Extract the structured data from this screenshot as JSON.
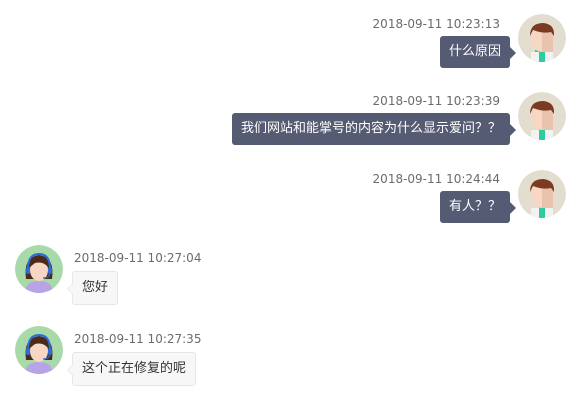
{
  "messages": [
    {
      "side": "out",
      "timestamp": "2018-09-11 10:23:13",
      "text": "什么原因"
    },
    {
      "side": "out",
      "timestamp": "2018-09-11 10:23:39",
      "text": "我们网站和能掌号的内容为什么显示爱问？？"
    },
    {
      "side": "out",
      "timestamp": "2018-09-11 10:24:44",
      "text": "有人？？"
    },
    {
      "side": "in",
      "timestamp": "2018-09-11 10:27:04",
      "text": "您好"
    },
    {
      "side": "in",
      "timestamp": "2018-09-11 10:27:35",
      "text": "这个正在修复的呢"
    }
  ],
  "avatars": {
    "user": "male-user-avatar",
    "agent": "female-agent-avatar-with-headset"
  },
  "colors": {
    "outgoing_bubble": "#555b72",
    "incoming_bubble": "#f7f7f8",
    "timestamp": "#6b6b6b"
  }
}
